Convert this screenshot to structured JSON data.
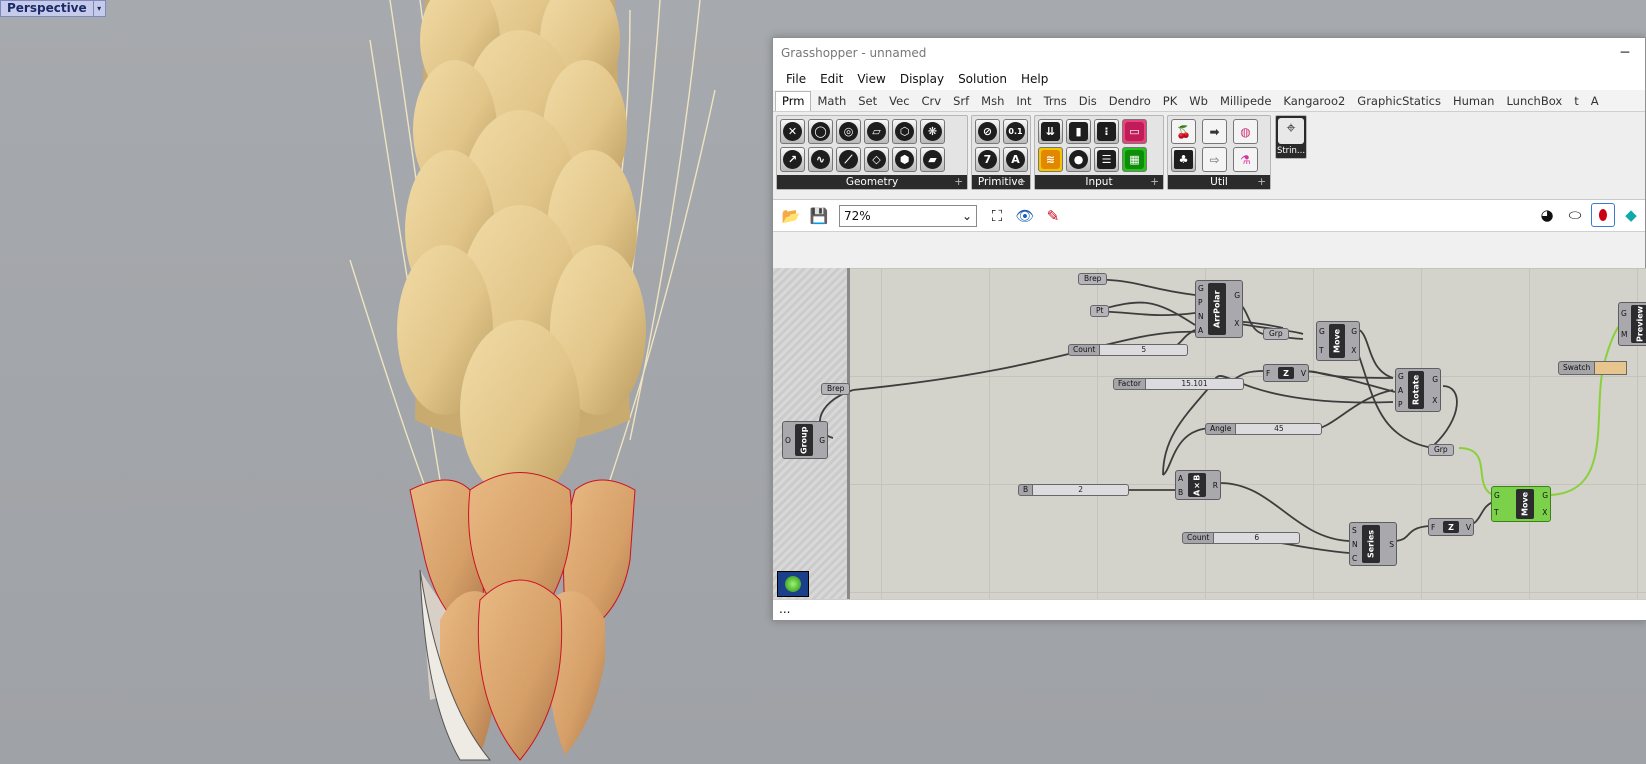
{
  "viewport": {
    "label": "Perspective",
    "dropdown": "▾"
  },
  "gh_window": {
    "title": "Grasshopper - unnamed",
    "window_controls": "─",
    "menu": [
      "File",
      "Edit",
      "View",
      "Display",
      "Solution",
      "Help"
    ],
    "tabs": [
      "Prm",
      "Math",
      "Set",
      "Vec",
      "Crv",
      "Srf",
      "Msh",
      "Int",
      "Trns",
      "Dis",
      "Dendro",
      "PK",
      "Wb",
      "Millipede",
      "Kangaroo2",
      "GraphicStatics",
      "Human",
      "LunchBox",
      "t",
      "A"
    ],
    "active_tab": "Prm",
    "ribbon_groups": [
      {
        "name": "Geometry",
        "expander": "+"
      },
      {
        "name": "Primitive",
        "expander": "+"
      },
      {
        "name": "Input",
        "expander": "+"
      },
      {
        "name": "Util",
        "expander": "+"
      }
    ],
    "primitive_icons": [
      "0.1",
      "7",
      "A"
    ],
    "extra_component": "Strin...",
    "zoom_value": "72%",
    "status_text": "..."
  },
  "canvas": {
    "params": {
      "brep_top": "Brep",
      "pt": "Pt",
      "brep_left": "Brep",
      "grp1": "Grp",
      "grp2": "Grp"
    },
    "sliders": {
      "count1": {
        "name": "Count",
        "value": "5"
      },
      "factor": {
        "name": "Factor",
        "value": "15.101"
      },
      "angle": {
        "name": "Angle",
        "value": "45"
      },
      "b": {
        "name": "B",
        "value": "2"
      },
      "count2": {
        "name": "Count",
        "value": "6"
      }
    },
    "swatch": {
      "name": "Swatch"
    },
    "nodes": {
      "arrpolar": {
        "title": "ArrPolar",
        "inputs": [
          "G",
          "P",
          "N",
          "A"
        ],
        "outputs": [
          "G",
          "X"
        ]
      },
      "move1": {
        "title": "Move",
        "inputs": [
          "G",
          "T"
        ],
        "outputs": [
          "G",
          "X"
        ]
      },
      "zvec1": {
        "title": "Z",
        "inputs": [
          "F"
        ],
        "outputs": [
          "V"
        ]
      },
      "rotate": {
        "title": "Rotate",
        "inputs": [
          "G",
          "A",
          "P"
        ],
        "outputs": [
          "G",
          "X"
        ]
      },
      "group": {
        "title": "Group",
        "inputs": [
          "O"
        ],
        "outputs": [
          "G"
        ]
      },
      "mult": {
        "title": "A×B",
        "inputs": [
          "A",
          "B"
        ],
        "outputs": [
          "R"
        ]
      },
      "series": {
        "title": "Series",
        "inputs": [
          "S",
          "N",
          "C"
        ],
        "outputs": [
          "S"
        ]
      },
      "zvec2": {
        "title": "Z",
        "inputs": [
          "F"
        ],
        "outputs": [
          "V"
        ]
      },
      "move2": {
        "title": "Move",
        "inputs": [
          "G",
          "T"
        ],
        "outputs": [
          "G",
          "X"
        ]
      },
      "preview": {
        "title": "Preview",
        "inputs": [
          "G",
          "M"
        ],
        "outputs": []
      }
    }
  },
  "colors": {
    "wire": "#3d3d3d",
    "wire_selected": "#8ad03b",
    "grain": "#e6cc8f",
    "husk": "#d9a56e",
    "swatch": "#e8c48e"
  }
}
